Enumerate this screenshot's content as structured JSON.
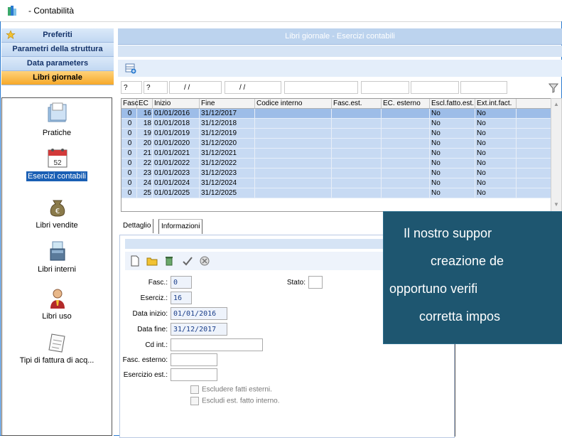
{
  "app": {
    "title": "- Contabilità",
    "accent": "#2b7bd0"
  },
  "nav": {
    "buttons": [
      {
        "label": "Preferiti",
        "icon": "star-icon"
      },
      {
        "label": "Parametri della struttura"
      },
      {
        "label": "Data parameters"
      },
      {
        "label": "Libri giornale",
        "active": true
      }
    ],
    "items": [
      {
        "label": "Pratiche",
        "icon": "folder-icon"
      },
      {
        "label": "Esercizi contabili",
        "icon": "calendar-icon",
        "selected": true,
        "calendar_number": "52"
      },
      {
        "label": "Libri vendite",
        "icon": "money-bag-icon"
      },
      {
        "label": "Libri interni",
        "icon": "document-stack-icon"
      },
      {
        "label": "Libri uso",
        "icon": "person-icon"
      },
      {
        "label": "Tipi di fattura di acq...",
        "icon": "receipt-icon"
      }
    ]
  },
  "main": {
    "header": "Libri giornale - Esercizi contabili",
    "filters": [
      "?",
      "?",
      "/ /",
      "/ /",
      "",
      "",
      "",
      ""
    ],
    "grid": {
      "columns": [
        "Fasc",
        "EC",
        "Inizio",
        "Fine",
        "Codice interno",
        "Fasc.est.",
        "EC. esterno",
        "Escl.fatto.est.",
        "Ext.int.fact."
      ],
      "rows": [
        [
          "0",
          "16",
          "01/01/2016",
          "31/12/2017",
          "",
          "",
          "",
          "No",
          "No"
        ],
        [
          "0",
          "18",
          "01/01/2018",
          "31/12/2018",
          "",
          "",
          "",
          "No",
          "No"
        ],
        [
          "0",
          "19",
          "01/01/2019",
          "31/12/2019",
          "",
          "",
          "",
          "No",
          "No"
        ],
        [
          "0",
          "20",
          "01/01/2020",
          "31/12/2020",
          "",
          "",
          "",
          "No",
          "No"
        ],
        [
          "0",
          "21",
          "01/01/2021",
          "31/12/2021",
          "",
          "",
          "",
          "No",
          "No"
        ],
        [
          "0",
          "22",
          "01/01/2022",
          "31/12/2022",
          "",
          "",
          "",
          "No",
          "No"
        ],
        [
          "0",
          "23",
          "01/01/2023",
          "31/12/2023",
          "",
          "",
          "",
          "No",
          "No"
        ],
        [
          "0",
          "24",
          "01/01/2024",
          "31/12/2024",
          "",
          "",
          "",
          "No",
          "No"
        ],
        [
          "0",
          "25",
          "01/01/2025",
          "31/12/2025",
          "",
          "",
          "",
          "No",
          "No"
        ]
      ]
    },
    "tabs": [
      "Dettaglio",
      "Informazioni link"
    ],
    "form": {
      "fasc_label": "Fasc.:",
      "fasc_value": "0",
      "stato_label": "Stato:",
      "stato_value": "",
      "eserciz_label": "Eserciz.:",
      "eserciz_value": "16",
      "data_inizio_label": "Data inizio:",
      "data_inizio_value": "01/01/2016",
      "data_fine_label": "Data fine:",
      "data_fine_value": "31/12/2017",
      "cd_int_label": "Cd int.:",
      "cd_int_value": "",
      "fasc_esterno_label": "Fasc. esterno:",
      "fasc_esterno_value": "",
      "esercizio_est_label": "Esercizio est.:",
      "esercizio_est_value": "",
      "chk1": "Escludere fatti esterni.",
      "chk2": "Escludi est. fatto interno."
    }
  },
  "overlay": {
    "lines": [
      "Il nostro suppor",
      "creazione de",
      "opportuno verifi",
      "corretta impos"
    ],
    "background": "#1e5670"
  }
}
